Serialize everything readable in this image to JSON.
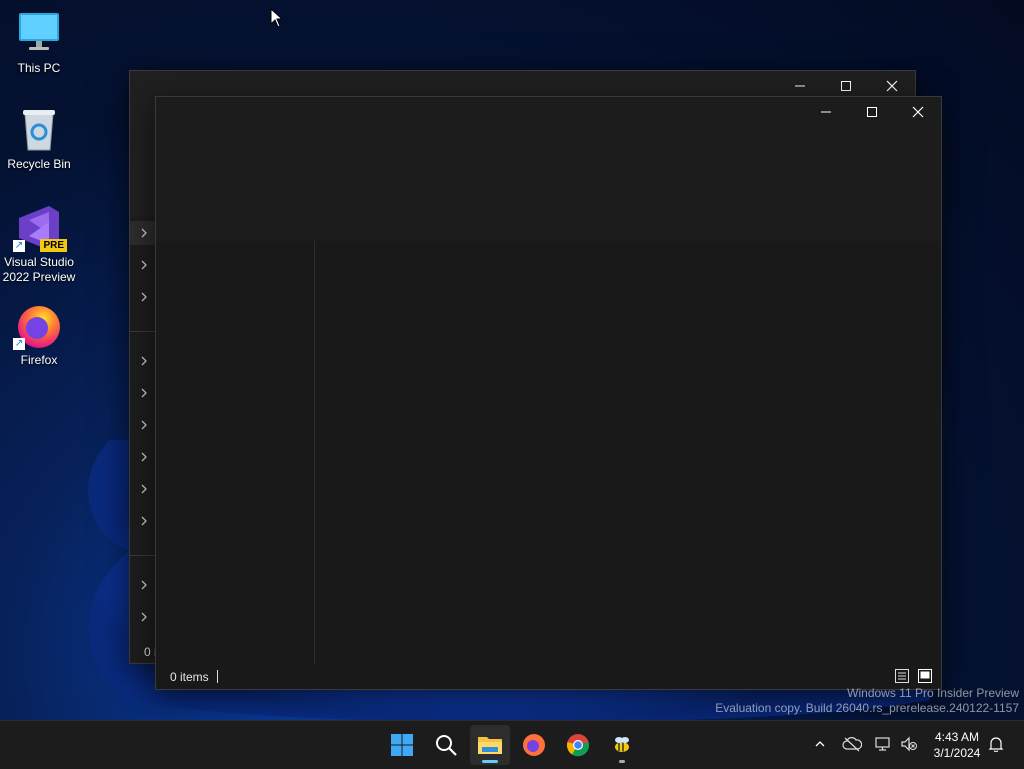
{
  "desktop": {
    "icons": [
      {
        "label": "This PC",
        "icon": "monitor-icon"
      },
      {
        "label": "Recycle Bin",
        "icon": "recycle-bin-icon"
      },
      {
        "label": "Visual Studio 2022 Preview",
        "icon": "visual-studio-icon",
        "badge": "PRE"
      },
      {
        "label": "Firefox",
        "icon": "firefox-icon"
      }
    ]
  },
  "back_window": {
    "status_text": "0 i"
  },
  "front_window": {
    "status_text": "0 items"
  },
  "watermark": {
    "line1": "Windows 11 Pro Insider Preview",
    "line2": "Evaluation copy. Build 26040.rs_prerelease.240122-1157"
  },
  "taskbar": {
    "apps": [
      "start-icon",
      "search-icon",
      "file-explorer-icon",
      "firefox-icon",
      "chrome-icon",
      "bee-app-icon"
    ],
    "clock_time": "4:43 AM",
    "clock_date": "3/1/2024"
  },
  "colors": {
    "accent": "#60cdff",
    "window_bg": "#1c1c1c",
    "taskbar_bg": "#1c1c1c"
  }
}
